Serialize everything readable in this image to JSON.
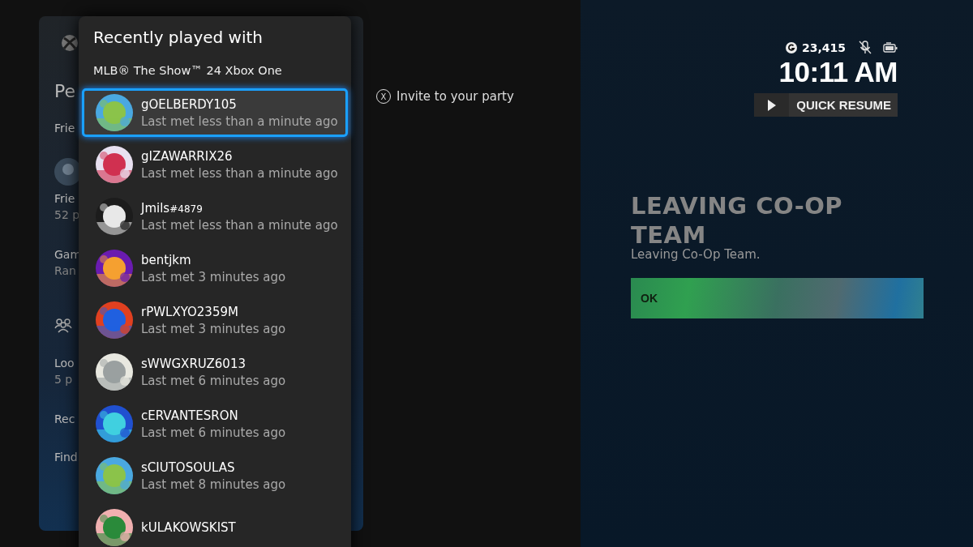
{
  "people_panel": {
    "title": "Pe",
    "items": [
      {
        "label": "Frie"
      },
      {
        "label": "Frie",
        "detail": "52 p"
      },
      {
        "label": "Gam",
        "detail": "Ran"
      },
      {
        "label": "Loo",
        "detail": "5 p"
      },
      {
        "label": "Rec"
      },
      {
        "label": "Find"
      }
    ]
  },
  "flyout": {
    "title": "Recently played with",
    "game": "MLB® The Show™ 24 Xbox One",
    "players": [
      {
        "gamertag": "gOELBERDY105",
        "last_met": "Last met less than a minute ago",
        "selected": true
      },
      {
        "gamertag": "gIZAWARRIX26",
        "last_met": "Last met less than a minute ago",
        "selected": false
      },
      {
        "gamertag": "Jmils",
        "suffix": "#4879",
        "last_met": "Last met less than a minute ago",
        "selected": false
      },
      {
        "gamertag": "bentjkm",
        "last_met": "Last met 3 minutes ago",
        "selected": false
      },
      {
        "gamertag": "rPWLXYO2359M",
        "last_met": "Last met 3 minutes ago",
        "selected": false
      },
      {
        "gamertag": "sWWGXRUZ6013",
        "last_met": "Last met 6 minutes ago",
        "selected": false
      },
      {
        "gamertag": "cERVANTESRON",
        "last_met": "Last met 6 minutes ago",
        "selected": false
      },
      {
        "gamertag": "sCIUTOSOULAS",
        "last_met": "Last met 8 minutes ago",
        "selected": false
      },
      {
        "gamertag": "kULAKOWSKIST",
        "selected": false
      }
    ]
  },
  "hint": {
    "button": "X",
    "label": "Invite to your party"
  },
  "status": {
    "gamerscore": "23,415",
    "time": "10:11 AM",
    "quick_resume": "QUICK RESUME"
  },
  "dialog": {
    "title": "LEAVING CO-OP TEAM",
    "message": "Leaving Co-Op Team.",
    "button": "OK"
  }
}
